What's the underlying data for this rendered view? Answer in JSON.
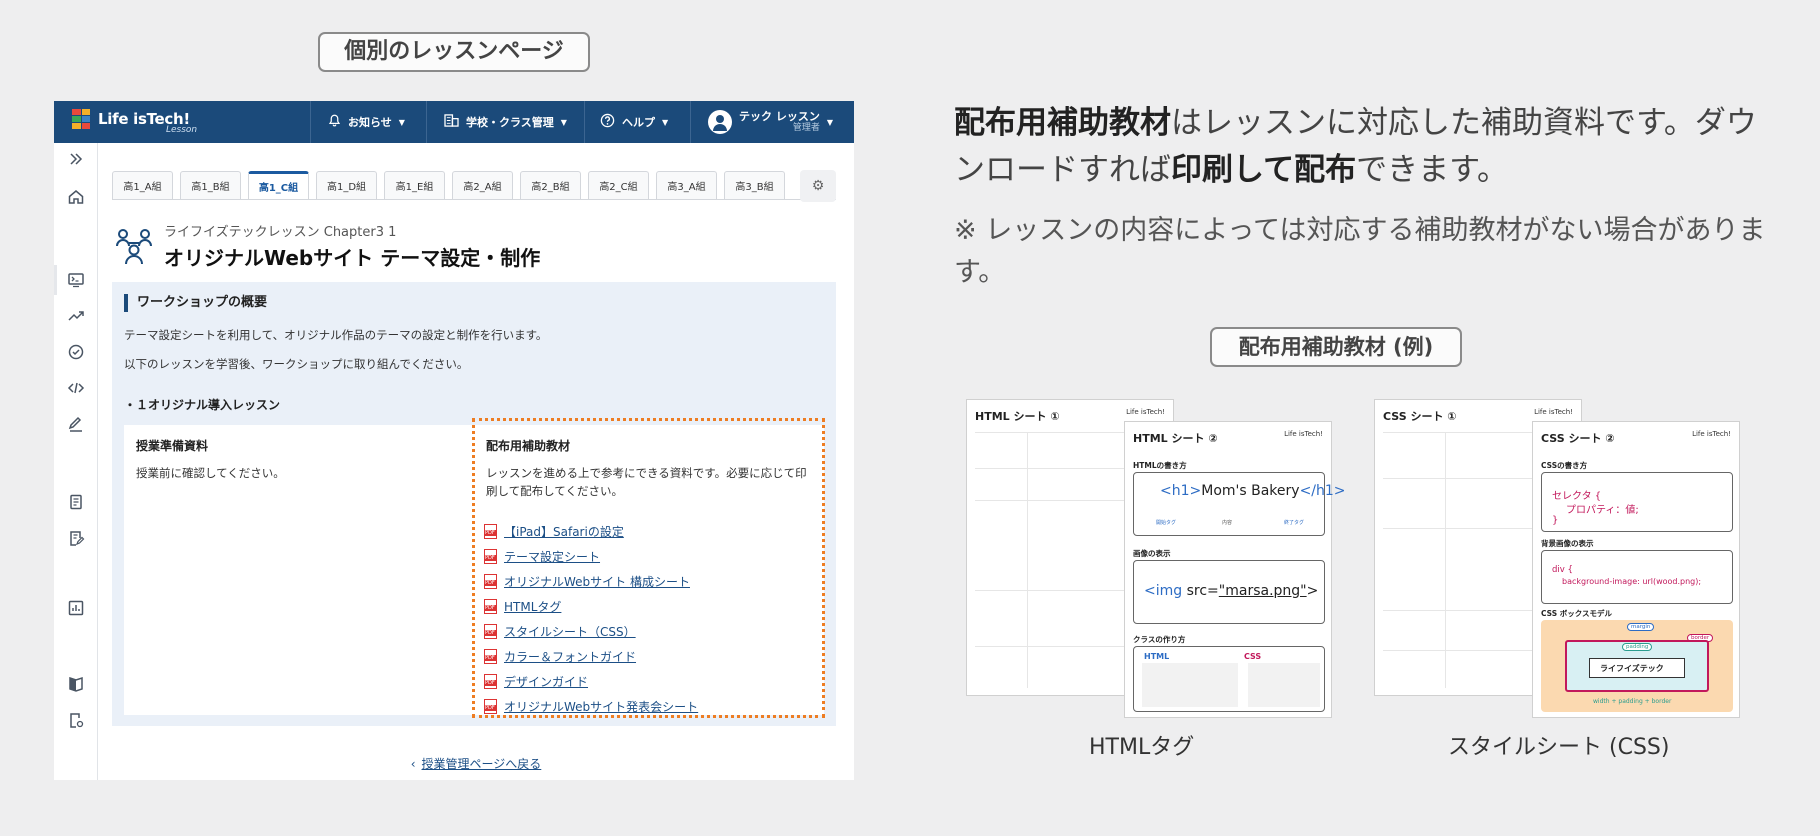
{
  "labels": {
    "top_pill": "個別のレッスンページ",
    "right_pill": "配布用補助教材 (例)"
  },
  "app": {
    "logo_text": "Life isTech!",
    "logo_sub": "Lesson",
    "nav": {
      "news": "お知らせ",
      "school": "学校・クラス管理",
      "help": "ヘルプ",
      "user_name": "テック レッスン",
      "user_role": "管理者"
    },
    "tabs": [
      "高1_A組",
      "高1_B組",
      "高1_C組",
      "高1_D組",
      "高1_E組",
      "高2_A組",
      "高2_B組",
      "高2_C組",
      "高3_A組",
      "高3_B組"
    ],
    "active_tab": 2,
    "lesson": {
      "subtitle": "ライフイズテックレッスン Chapter3 1",
      "title": "オリジナルWebサイト テーマ設定・制作"
    },
    "overview": {
      "heading": "ワークショップの概要",
      "text1": "テーマ設定シートを利用して、オリジナル作品のテーマの設定と制作を行います。",
      "text2": "以下のレッスンを学習後、ワークショップに取り組んでください。",
      "lesson_item": "・１オリジナル導入レッスン"
    },
    "prep_card": {
      "title": "授業準備資料",
      "text": "授業前に確認してください。"
    },
    "supp_card": {
      "title": "配布用補助教材",
      "text": "レッスンを進める上で参考にできる資料です。必要に応じて印刷して配布してください。",
      "links": [
        "【iPad】Safariの設定",
        "テーマ設定シート",
        "オリジナルWebサイト 構成シート",
        "HTMLタグ",
        "スタイルシート（CSS）",
        "カラー＆フォントガイド",
        "デザインガイド",
        "オリジナルWebサイト発表会シート"
      ]
    },
    "back_link": "授業管理ページへ戻る"
  },
  "right": {
    "desc_bold1": "配布用補助教材",
    "desc_mid1": "はレッスンに対応した補助資料です。ダウンロードすれば",
    "desc_bold2": "印刷して配布",
    "desc_end": "できます。",
    "note": "※ レッスンの内容によっては対応する補助教材がない場合があります。",
    "html_sheets": {
      "sheet1_title": "HTML シート ①",
      "sheet2_title": "HTML シート ②",
      "logo": "Life isTech!",
      "sec1": "HTMLの書き方",
      "code1_open": "<h1>",
      "code1_text": "Mom's Bakery",
      "code1_close": "</h1>",
      "code1_notes": [
        "開始タグ",
        "内容",
        "終了タグ"
      ],
      "sec2": "画像の表示",
      "code2_a": "<img ",
      "code2_b": "src=",
      "code2_c": "\"marsa.png\"",
      "code2_d": ">",
      "sec3": "クラスの作り方",
      "html_label": "HTML",
      "css_label": "CSS",
      "caption": "HTMLタグ"
    },
    "css_sheets": {
      "sheet1_title": "CSS シート ①",
      "sheet2_title": "CSS シート ②",
      "logo": "Life isTech!",
      "sec1": "CSSの書き方",
      "selector": "セレクタ {",
      "prop": "プロパティ：値;",
      "close": "}",
      "sec2": "背景画像の表示",
      "bg_sel": "div {",
      "bg_prop": "background-image: url(wood.png);",
      "sec3": "CSS ボックスモデル",
      "box_label": "ライフイズテック",
      "box_margin": "margin",
      "box_padding": "padding",
      "box_border": "border",
      "box_formula": "width + padding + border",
      "caption": "スタイルシート (CSS)"
    }
  },
  "colors": {
    "topbar": "#1b4a7a",
    "link": "#1c4f86",
    "highlight_border": "#ee7d22",
    "overview_bg": "#eaf0f8"
  }
}
